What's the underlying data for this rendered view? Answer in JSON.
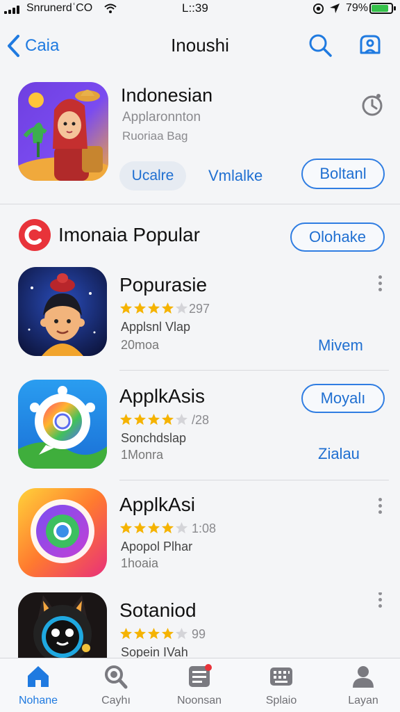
{
  "status_bar": {
    "carrier": "SnrunerdʿCO",
    "time": "L::39",
    "battery": "79%"
  },
  "nav": {
    "back_label": "Caia",
    "title": "Inoushi"
  },
  "featured": {
    "title": "Indonesian",
    "subtitle_1": "Applaronnton",
    "subtitle_2": "Ruoriaa Bag",
    "chip_label": "Ucalre",
    "link_label": "Vmlalke",
    "button_label": "Boltanl"
  },
  "section": {
    "title": "Imonaia Popular",
    "button_label": "Olohake"
  },
  "apps": [
    {
      "name": "Popurasie",
      "rating": 4,
      "rating_count": "297",
      "subtitle": "Applsnl Vlap",
      "size": "20moa",
      "action": "Mivem"
    },
    {
      "name": "ApplkAsis",
      "rating": 4,
      "rating_count": "/28",
      "subtitle": "Sonchdslap",
      "size": "1Monra",
      "action": "Zialau",
      "pill": "Moyalı"
    },
    {
      "name": "ApplkAsi",
      "rating": 4,
      "rating_count": "1:08",
      "subtitle": "Apopol Plhar",
      "size": "1hoaia"
    },
    {
      "name": "Sotaniod",
      "rating": 4,
      "rating_count": "99",
      "subtitle": "Sopein IVah"
    }
  ],
  "tabs": [
    {
      "label": "Nohane",
      "icon": "home-icon",
      "active": true
    },
    {
      "label": "Cayhı",
      "icon": "search-icon"
    },
    {
      "label": "Noonsan",
      "icon": "news-icon"
    },
    {
      "label": "Splaio",
      "icon": "keyboard-icon"
    },
    {
      "label": "Layan",
      "icon": "person-icon"
    }
  ],
  "colors": {
    "accent": "#1f7ae0",
    "star": "#f5b301",
    "section_badge": "#e8333a",
    "battery": "#35c14a"
  }
}
